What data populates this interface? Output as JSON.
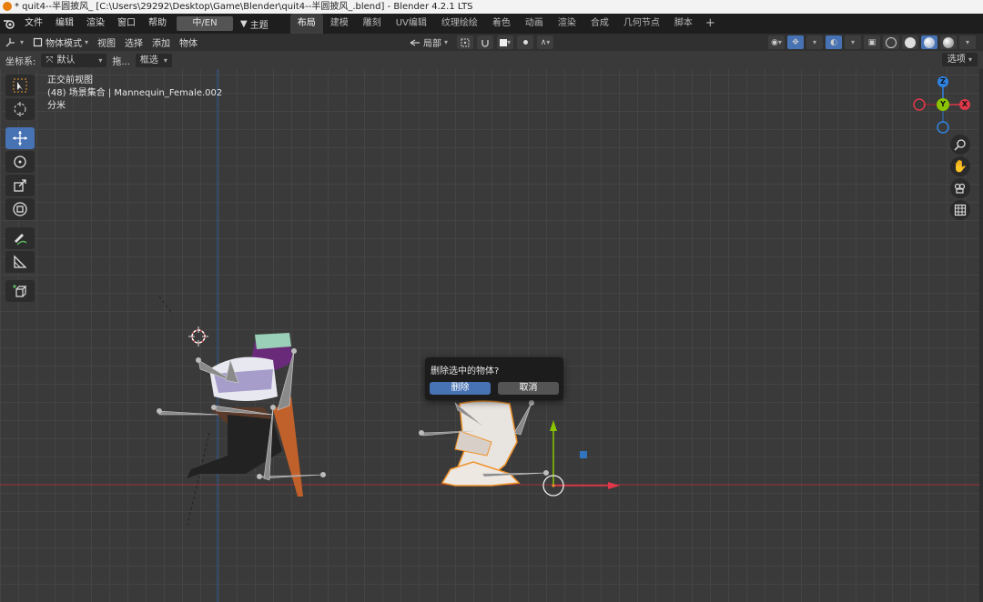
{
  "window": {
    "title": "* quit4--半圆披风_ [C:\\Users\\29292\\Desktop\\Game\\Blender\\quit4--半圆披风_.blend] - Blender 4.2.1 LTS"
  },
  "menu": {
    "items": [
      "文件",
      "编辑",
      "渲染",
      "窗口",
      "帮助"
    ],
    "language": "中/EN",
    "theme": "主题"
  },
  "tabs": [
    "布局",
    "建模",
    "雕刻",
    "UV编辑",
    "纹理绘绘",
    "着色",
    "动画",
    "渲染",
    "合成",
    "几何节点",
    "脚本"
  ],
  "viewport_header": {
    "mode": "物体模式",
    "menus": [
      "视图",
      "选择",
      "添加",
      "物体"
    ],
    "pivot": "局部"
  },
  "subheader": {
    "coord_label": "坐标系:",
    "coord_value": "默认",
    "drag_label": "拖...",
    "select_mode": "框选",
    "options": "选项"
  },
  "viewport_info": {
    "view_name": "正交前视图",
    "collection": "(48) 场景集合 | Mannequin_Female.002",
    "units": "分米"
  },
  "gizmo": {
    "z_label": "Z",
    "y_label": "Y",
    "x_label": "X",
    "colors": {
      "x": "#e0384a",
      "y": "#8ac400",
      "z": "#2f83e0"
    }
  },
  "dialog": {
    "message": "删除选中的物体?",
    "confirm": "删除",
    "cancel": "取消"
  },
  "accent": "#4772b3"
}
